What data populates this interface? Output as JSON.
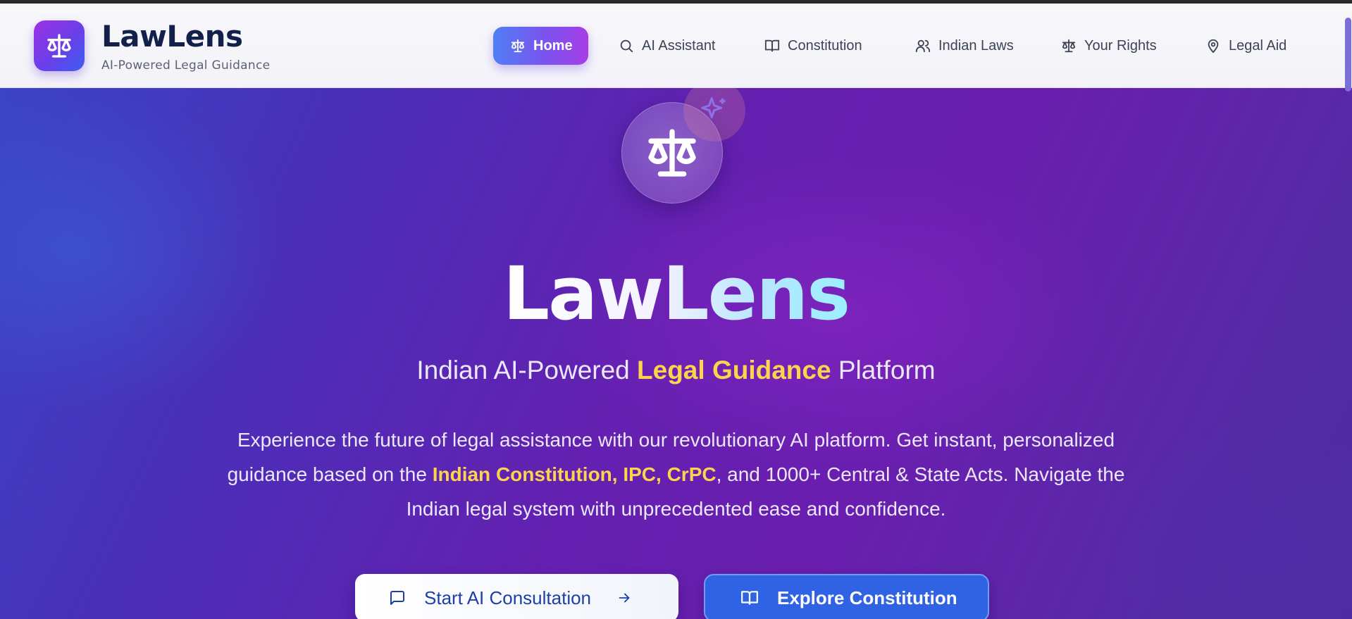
{
  "header": {
    "brand_name": "LawLens",
    "brand_tagline": "AI-Powered Legal Guidance",
    "logo_icon": "scales-icon"
  },
  "nav": {
    "items": [
      {
        "label": "Home",
        "icon": "scales-icon",
        "active": true
      },
      {
        "label": "AI Assistant",
        "icon": "search-icon",
        "active": false
      },
      {
        "label": "Constitution",
        "icon": "book-icon",
        "active": false
      },
      {
        "label": "Indian Laws",
        "icon": "users-icon",
        "active": false
      },
      {
        "label": "Your Rights",
        "icon": "scales-icon",
        "active": false
      },
      {
        "label": "Legal Aid",
        "icon": "map-pin-icon",
        "active": false
      }
    ]
  },
  "hero": {
    "emblem_icon": "scales-icon",
    "badge_icon": "sparkle-icon",
    "title": "LawLens",
    "subtitle_pre": "Indian AI-Powered ",
    "subtitle_highlight": "Legal Guidance",
    "subtitle_post": " Platform",
    "desc_line1": "Experience the future of legal assistance with our revolutionary AI platform. Get instant, personalized",
    "desc_line2_pre": "guidance based on the ",
    "desc_line2_highlight": "Indian Constitution, IPC, CrPC",
    "desc_line2_post": ", and 1000+ Central & State Acts. Navigate the",
    "desc_line3": "Indian legal system with unprecedented ease and confidence.",
    "primary_button": {
      "label": "Start AI Consultation",
      "icon": "message-square-icon",
      "trailing_icon": "arrow-right-icon"
    },
    "secondary_button": {
      "label": "Explore Constitution",
      "icon": "book-open-icon"
    }
  },
  "colors": {
    "accent_yellow": "#fcd34d",
    "brand_navy": "#13204a",
    "nav_active_start": "#4f7ff4",
    "nav_active_end": "#a63ee6",
    "button_blue": "#2f63e3"
  }
}
